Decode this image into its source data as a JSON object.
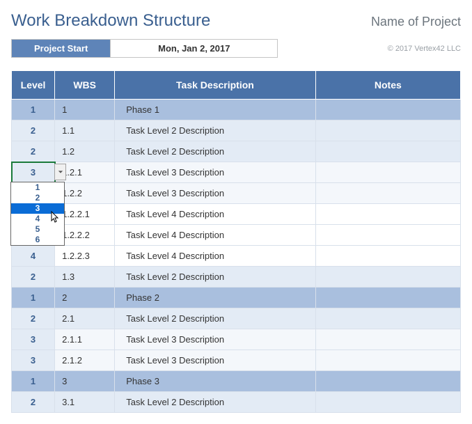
{
  "header": {
    "title": "Work Breakdown Structure",
    "project_name": "Name of Project"
  },
  "project_start": {
    "label": "Project Start",
    "date": "Mon, Jan 2, 2017"
  },
  "copyright": "© 2017 Vertex42 LLC",
  "columns": {
    "level": "Level",
    "wbs": "WBS",
    "desc": "Task Description",
    "notes": "Notes"
  },
  "dropdown": {
    "options": [
      "1",
      "2",
      "3",
      "4",
      "5",
      "6"
    ],
    "selected": "3"
  },
  "rows": [
    {
      "level": "1",
      "wbs": "1",
      "desc": "Phase 1",
      "notes": "",
      "lv": 1
    },
    {
      "level": "2",
      "wbs": "1.1",
      "desc": "Task Level 2 Description",
      "notes": "",
      "lv": 2
    },
    {
      "level": "2",
      "wbs": "1.2",
      "desc": "Task Level 2 Description",
      "notes": "",
      "lv": 2
    },
    {
      "level": "3",
      "wbs": "1.2.1",
      "desc": "Task Level 3 Description",
      "notes": "",
      "lv": 3,
      "active": true
    },
    {
      "level": "",
      "wbs": "1.2.2",
      "desc": "Task Level 3 Description",
      "notes": "",
      "lv": 3
    },
    {
      "level": "",
      "wbs": "1.2.2.1",
      "desc": "Task Level 4 Description",
      "notes": "",
      "lv": 4
    },
    {
      "level": "",
      "wbs": "1.2.2.2",
      "desc": "Task Level 4 Description",
      "notes": "",
      "lv": 4
    },
    {
      "level": "4",
      "wbs": "1.2.2.3",
      "desc": "Task Level 4 Description",
      "notes": "",
      "lv": 4
    },
    {
      "level": "2",
      "wbs": "1.3",
      "desc": "Task Level 2 Description",
      "notes": "",
      "lv": 2
    },
    {
      "level": "1",
      "wbs": "2",
      "desc": "Phase 2",
      "notes": "",
      "lv": 1
    },
    {
      "level": "2",
      "wbs": "2.1",
      "desc": "Task Level 2 Description",
      "notes": "",
      "lv": 2
    },
    {
      "level": "3",
      "wbs": "2.1.1",
      "desc": "Task Level 3 Description",
      "notes": "",
      "lv": 3
    },
    {
      "level": "3",
      "wbs": "2.1.2",
      "desc": "Task Level 3 Description",
      "notes": "",
      "lv": 3
    },
    {
      "level": "1",
      "wbs": "3",
      "desc": "Phase 3",
      "notes": "",
      "lv": 1
    },
    {
      "level": "2",
      "wbs": "3.1",
      "desc": "Task Level 2 Description",
      "notes": "",
      "lv": 2
    }
  ]
}
